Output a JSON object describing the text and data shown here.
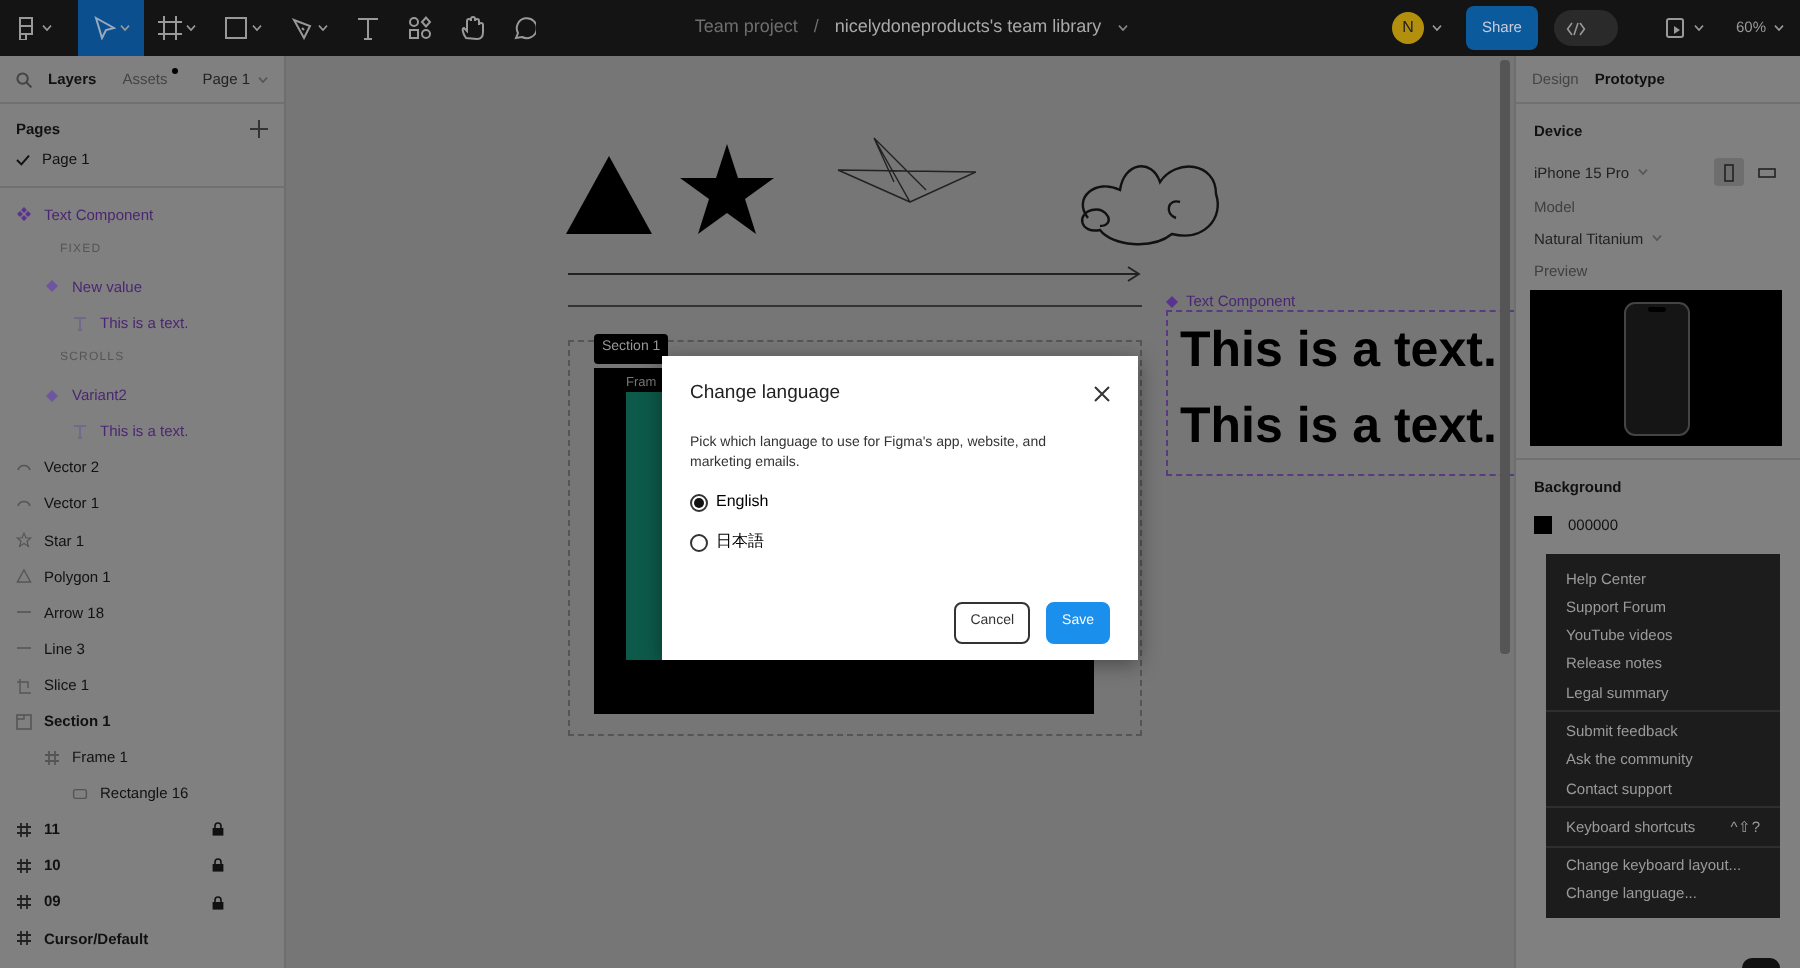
{
  "toolbar": {
    "tools": [
      {
        "kind": "logo",
        "selected": false,
        "caret": true
      },
      {
        "kind": "move",
        "selected": true,
        "caret": true
      },
      {
        "kind": "frame",
        "selected": false,
        "caret": true
      },
      {
        "kind": "shape",
        "selected": false,
        "caret": true
      },
      {
        "kind": "pen",
        "selected": false,
        "caret": true
      },
      {
        "kind": "text",
        "selected": false,
        "caret": false
      },
      {
        "kind": "resources",
        "selected": false,
        "caret": false
      },
      {
        "kind": "hand",
        "selected": false,
        "caret": false
      },
      {
        "kind": "comment",
        "selected": false,
        "caret": false
      }
    ],
    "code_mode": {
      "on": false
    },
    "project": "Team project",
    "separator": "/",
    "file": "nicelydoneproducts's team library",
    "avatar": "N",
    "share": "Share",
    "zoom": "60%"
  },
  "left_panel": {
    "tabs": [
      {
        "label": "Layers",
        "selected": true,
        "dot": false
      },
      {
        "label": "Assets",
        "selected": false,
        "dot": true
      }
    ],
    "page_menu": "Page 1",
    "pages_title": "Pages",
    "pages": [
      {
        "label": "Page 1",
        "selected": true
      }
    ],
    "layers": [
      {
        "label": "Text Component",
        "kind": "component",
        "locked": false,
        "children": [
          {
            "label": "FIXED",
            "kind": "heading"
          },
          {
            "label": "New value",
            "kind": "variant",
            "locked": false,
            "children": [
              {
                "label": "This is a text.",
                "kind": "text",
                "locked": false
              }
            ]
          },
          {
            "label": "SCROLLS",
            "kind": "heading"
          },
          {
            "label": "Variant2",
            "kind": "variant",
            "locked": false,
            "children": [
              {
                "label": "This is a text.",
                "kind": "text",
                "locked": false
              }
            ]
          }
        ]
      },
      {
        "label": "Vector 2",
        "kind": "vector",
        "locked": false
      },
      {
        "label": "Vector 1",
        "kind": "vector",
        "locked": false
      },
      {
        "label": "Star 1",
        "kind": "star",
        "locked": false
      },
      {
        "label": "Polygon 1",
        "kind": "polygon",
        "locked": false
      },
      {
        "label": "Arrow 18",
        "kind": "line",
        "locked": false
      },
      {
        "label": "Line 3",
        "kind": "line",
        "locked": false
      },
      {
        "label": "Slice 1",
        "kind": "slice",
        "locked": false
      },
      {
        "label": "Section 1",
        "kind": "section",
        "locked": false,
        "children": [
          {
            "label": "Frame 1",
            "kind": "frame",
            "locked": false,
            "children": [
              {
                "label": "Rectangle 16",
                "kind": "rectangle",
                "locked": false
              }
            ]
          }
        ]
      },
      {
        "label": "11",
        "kind": "frame",
        "locked": true
      },
      {
        "label": "10",
        "kind": "frame",
        "locked": true
      },
      {
        "label": "09",
        "kind": "frame",
        "locked": true
      },
      {
        "label": "Cursor/Default",
        "kind": "frame",
        "locked": false
      }
    ]
  },
  "canvas": {
    "section_label": "Section 1",
    "frame_label": "Fram",
    "component_label": "Text Component",
    "texts": [
      "This is a text.",
      "This is a text."
    ]
  },
  "dialog": {
    "title": "Change language",
    "description": "Pick which language to use for Figma's app, website, and marketing emails.",
    "options": [
      {
        "label": "English",
        "selected": true
      },
      {
        "label": "日本語",
        "selected": false
      }
    ],
    "buttons": [
      {
        "label": "Cancel",
        "kind": "secondary"
      },
      {
        "label": "Save",
        "kind": "primary"
      }
    ]
  },
  "right_panel": {
    "tabs": [
      {
        "label": "Design",
        "selected": false
      },
      {
        "label": "Prototype",
        "selected": true
      }
    ],
    "device_title": "Device",
    "device": "iPhone 15 Pro",
    "orientations": [
      {
        "kind": "portrait",
        "selected": true
      },
      {
        "kind": "landscape",
        "selected": false
      }
    ],
    "model_title": "Model",
    "model": "Natural Titanium",
    "preview_title": "Preview",
    "background_title": "Background",
    "background_hex": "000000"
  },
  "help_menu": {
    "groups": [
      {
        "items": [
          {
            "label": "Help Center"
          },
          {
            "label": "Support Forum"
          },
          {
            "label": "YouTube videos"
          },
          {
            "label": "Release notes"
          },
          {
            "label": "Legal summary"
          }
        ]
      },
      {
        "items": [
          {
            "label": "Submit feedback"
          },
          {
            "label": "Ask the community"
          },
          {
            "label": "Contact support"
          }
        ]
      },
      {
        "items": [
          {
            "label": "Keyboard shortcuts",
            "shortcut": "^⇧?"
          }
        ]
      },
      {
        "items": [
          {
            "label": "Change keyboard layout..."
          },
          {
            "label": "Change language..."
          }
        ]
      }
    ]
  }
}
